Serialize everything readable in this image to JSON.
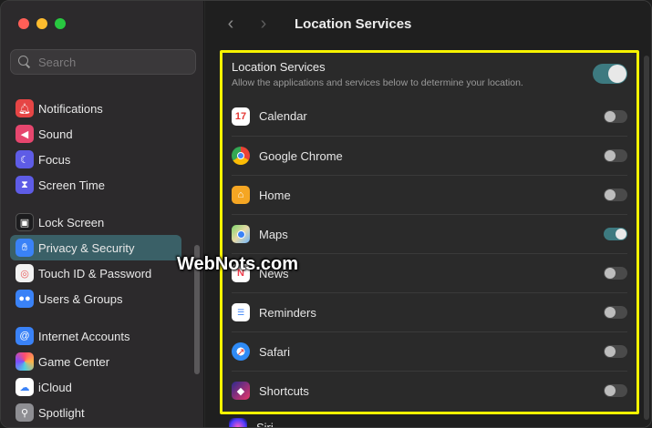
{
  "window": {
    "title": "Location Services"
  },
  "search": {
    "placeholder": "Search"
  },
  "sidebar": {
    "items": [
      {
        "label": "Notifications",
        "icon": "bell-icon",
        "color": "#e64545"
      },
      {
        "label": "Sound",
        "icon": "speaker-icon",
        "color": "#e6466e"
      },
      {
        "label": "Focus",
        "icon": "moon-icon",
        "color": "#5e5ce6"
      },
      {
        "label": "Screen Time",
        "icon": "hourglass-icon",
        "color": "#5e5ce6"
      },
      {
        "label": "Lock Screen",
        "icon": "lock-icon",
        "color": "#1c1c1e"
      },
      {
        "label": "Privacy & Security",
        "icon": "hand-icon",
        "color": "#3a82f7",
        "active": true
      },
      {
        "label": "Touch ID & Password",
        "icon": "fingerprint-icon",
        "color": "#e85d5d"
      },
      {
        "label": "Users & Groups",
        "icon": "users-icon",
        "color": "#3a82f7"
      },
      {
        "label": "Internet Accounts",
        "icon": "at-icon",
        "color": "#3a82f7"
      },
      {
        "label": "Game Center",
        "icon": "game-center-icon",
        "color": "#e0e0e0"
      },
      {
        "label": "iCloud",
        "icon": "cloud-icon",
        "color": "#ffffff"
      },
      {
        "label": "Spotlight",
        "icon": "magnifier-icon",
        "color": "#8e8e93"
      }
    ]
  },
  "panel": {
    "header_title": "Location Services",
    "header_subtitle": "Allow the applications and services below to determine your location.",
    "master_on": true,
    "apps": [
      {
        "label": "Calendar",
        "icon": "calendar-icon",
        "on": false
      },
      {
        "label": "Google Chrome",
        "icon": "chrome-icon",
        "on": false
      },
      {
        "label": "Home",
        "icon": "home-icon",
        "on": false
      },
      {
        "label": "Maps",
        "icon": "maps-icon",
        "on": true
      },
      {
        "label": "News",
        "icon": "news-icon",
        "on": false
      },
      {
        "label": "Reminders",
        "icon": "reminders-icon",
        "on": false
      },
      {
        "label": "Safari",
        "icon": "safari-icon",
        "on": false
      },
      {
        "label": "Shortcuts",
        "icon": "shortcuts-icon",
        "on": false
      }
    ],
    "next_app": {
      "label": "Siri",
      "icon": "siri-icon"
    }
  },
  "watermark": "WebNots.com",
  "colors": {
    "highlight": "#f7f300",
    "accent": "#3d7a80",
    "active_item": "#3a6067"
  }
}
